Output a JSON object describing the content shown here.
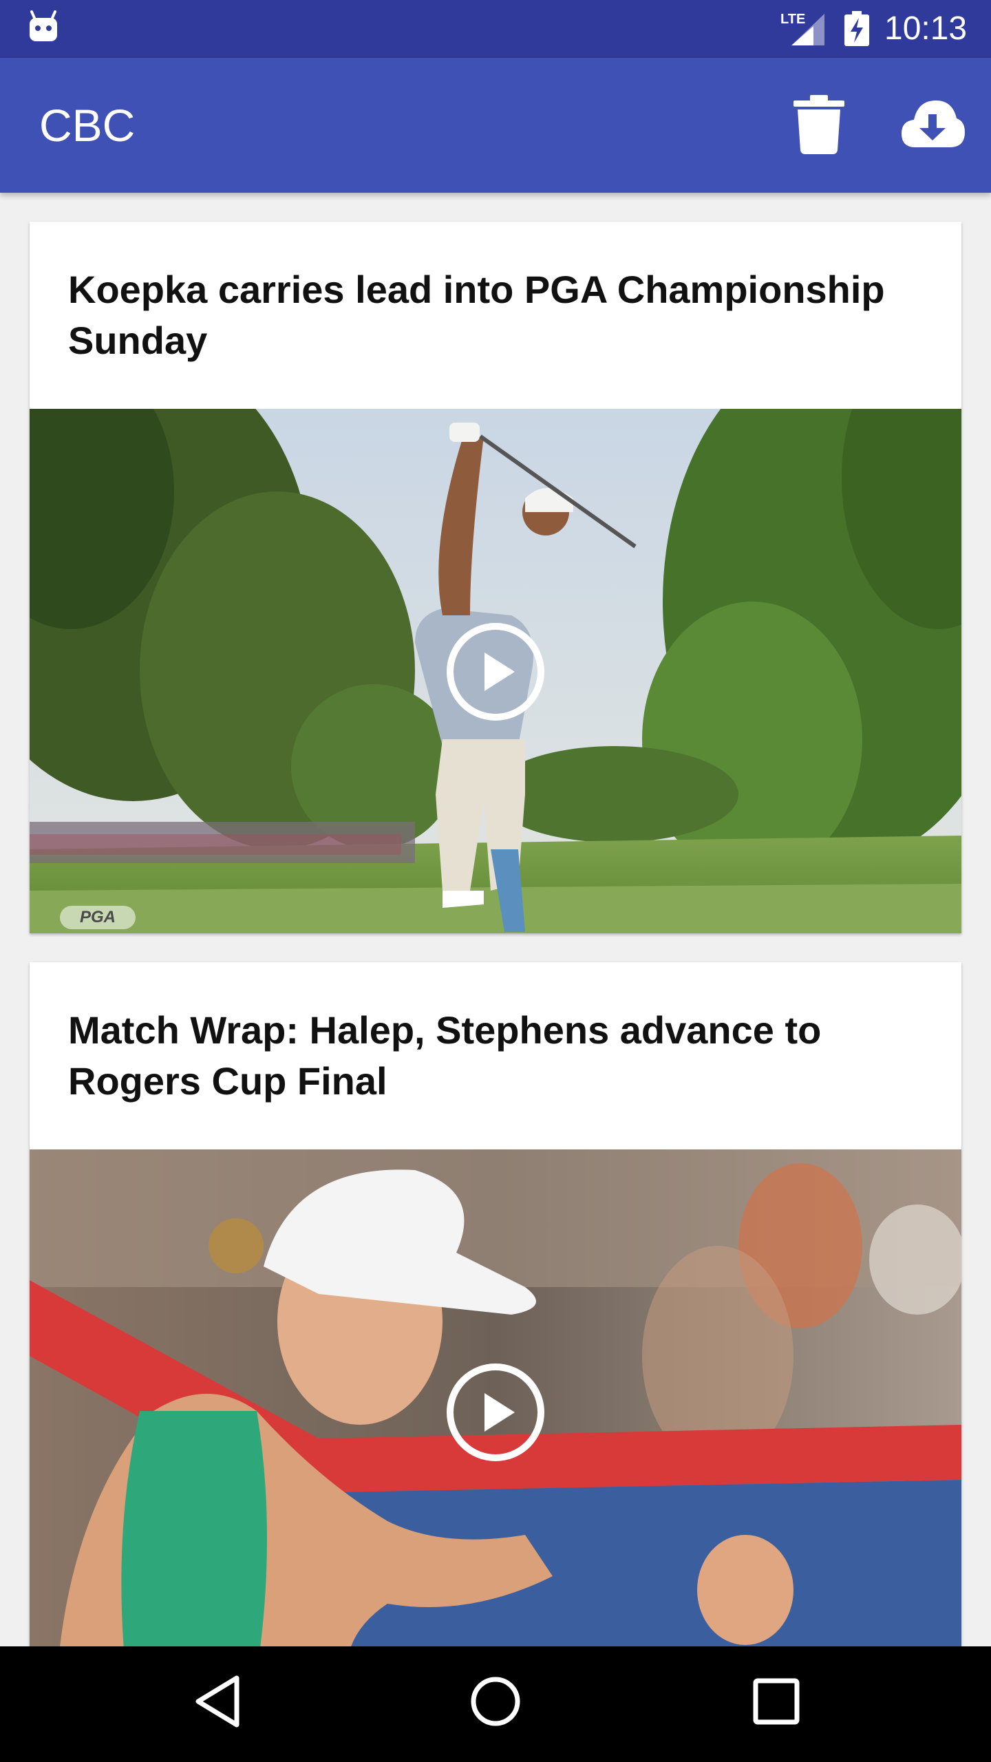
{
  "status_bar": {
    "time": "10:13",
    "network": "LTE",
    "icons": [
      "android-icon",
      "lte-signal-icon",
      "battery-charging-icon"
    ]
  },
  "app_bar": {
    "title": "CBC",
    "actions": [
      {
        "name": "delete",
        "icon": "trash-icon"
      },
      {
        "name": "download",
        "icon": "cloud-download-icon"
      }
    ]
  },
  "feed": {
    "items": [
      {
        "headline": "Koepka carries lead into PGA Championship Sunday",
        "media_type": "video",
        "watermark": "PGA"
      },
      {
        "headline": "Match Wrap: Halep, Stephens advance to Rogers Cup Final",
        "media_type": "video"
      }
    ]
  },
  "nav_bar": {
    "buttons": [
      "back-icon",
      "home-icon",
      "recents-icon"
    ]
  },
  "colors": {
    "status_bar": "#2f3a9a",
    "app_bar": "#3f51b5",
    "background": "#f0f0f0",
    "card": "#ffffff",
    "nav_bar": "#000000"
  }
}
